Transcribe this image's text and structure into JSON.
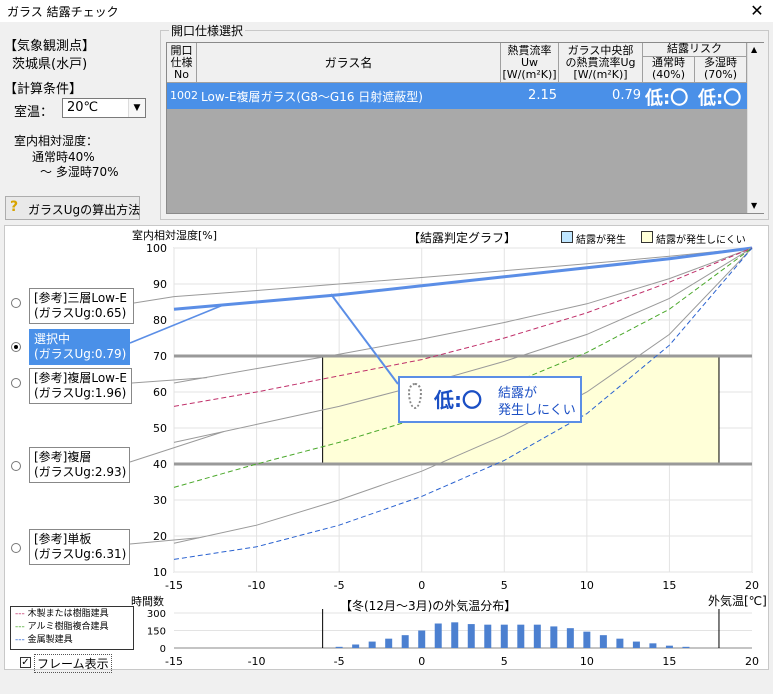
{
  "window": {
    "title": "ガラス 結露チェック",
    "close": "✕"
  },
  "station": {
    "heading": "【気象観測点】",
    "name": "茨城県(水戸)"
  },
  "conditions": {
    "heading": "【計算条件】",
    "room_temp_label": "室温：",
    "room_temp_value": "20℃",
    "humidity_label": "室内相対湿度：",
    "humidity_normal": "通常時40%",
    "humidity_high": "～ 多湿時70%"
  },
  "ug_button": "ガラスUgの算出方法",
  "spec_table": {
    "group_title": "開口仕様選択",
    "headers": {
      "no": [
        "開口",
        "仕様",
        "No"
      ],
      "name": "ガラス名",
      "uw": [
        "熱貫流率",
        "Uw",
        "[W/(m²K)]"
      ],
      "ug": [
        "ガラス中央部",
        "の熱貫流率Ug",
        "[W/(m²K)]"
      ],
      "risk": "結露リスク",
      "normal": [
        "通常時",
        "(40%)"
      ],
      "humid": [
        "多湿時",
        "(70%)"
      ]
    },
    "row": {
      "no": "1002",
      "name": "Low-E複層ガラス(G8～G16 日射遮蔽型)",
      "uw": "2.15",
      "ug": "0.79",
      "normal": "低:〇",
      "humid": "低:〇"
    }
  },
  "graph": {
    "ylabel": "室内相対湿度[%]",
    "title": "【結露判定グラフ】",
    "legend_occurs": "結露が発生",
    "legend_unlikely": "結露が発生しにくい",
    "xlabel": "外気温[℃]",
    "result_main": "低:〇",
    "result_sub1": "結露が",
    "result_sub2": "発生しにくい",
    "yticks": [
      "100",
      "90",
      "80",
      "70",
      "60",
      "50",
      "40",
      "30",
      "20",
      "10"
    ],
    "xticks": [
      "-15",
      "-10",
      "-5",
      "0",
      "5",
      "10",
      "15",
      "20"
    ]
  },
  "glass_options": [
    {
      "label1": "[参考]三層Low-E",
      "label2": "(ガラスUg:0.65)"
    },
    {
      "label1": "選択中",
      "label2": "(ガラスUg:0.79)"
    },
    {
      "label1": "[参考]複層Low-E",
      "label2": "(ガラスUg:1.96)"
    },
    {
      "label1": "[参考]複層",
      "label2": "(ガラスUg:2.93)"
    },
    {
      "label1": "[参考]単板",
      "label2": "(ガラスUg:6.31)"
    }
  ],
  "frame_legend": [
    "木製または樹脂建具",
    "アルミ樹脂複合建具",
    "金属製建具"
  ],
  "hist": {
    "ylabel": "時間数",
    "title": "【冬(12月～3月)の外気温分布】",
    "yticks": [
      "300",
      "150",
      "0"
    ]
  },
  "frame_display": "フレーム表示",
  "chart_data": {
    "type": "line",
    "title": "【結露判定グラフ】",
    "xlabel": "外気温[℃]",
    "ylabel": "室内相対湿度[%]",
    "xlim": [
      -15,
      20
    ],
    "ylim": [
      10,
      100
    ],
    "no_condensation_zone": {
      "x": [
        -6,
        18
      ],
      "y": [
        40,
        70
      ]
    },
    "series": [
      {
        "name": "[参考]三層Low-E",
        "x": [
          -15,
          -10,
          -5,
          0,
          5,
          10,
          15,
          20
        ],
        "y": [
          86.5,
          88.2,
          90,
          91.8,
          93.7,
          95.6,
          97.7,
          100
        ]
      },
      {
        "name": "選択中",
        "x": [
          -15,
          -10,
          -5,
          0,
          5,
          10,
          15,
          20
        ],
        "y": [
          83,
          85,
          87,
          89.5,
          92,
          94.5,
          97,
          100
        ]
      },
      {
        "name": "[参考]複層Low-E",
        "x": [
          -15,
          -10,
          -5,
          0,
          5,
          10,
          15,
          20
        ],
        "y": [
          62.5,
          66.5,
          70.5,
          74.7,
          79.3,
          84.5,
          91.5,
          100
        ]
      },
      {
        "name": "[参考]複層",
        "x": [
          -15,
          -10,
          -5,
          0,
          5,
          10,
          15,
          20
        ],
        "y": [
          46,
          51,
          56,
          62,
          68.5,
          76,
          86,
          100
        ]
      },
      {
        "name": "[参考]単板",
        "x": [
          -15,
          -10,
          -5,
          0,
          5,
          10,
          15,
          20
        ],
        "y": [
          18,
          23,
          30,
          38,
          48,
          60,
          76,
          100
        ]
      },
      {
        "name": "木製または樹脂建具",
        "x": [
          -15,
          -10,
          -5,
          0,
          5,
          10,
          15,
          20
        ],
        "y": [
          56,
          60,
          64.5,
          69,
          75,
          82,
          90.5,
          100
        ]
      },
      {
        "name": "アルミ樹脂複合建具",
        "x": [
          -15,
          -10,
          -5,
          0,
          5,
          10,
          15,
          20
        ],
        "y": [
          33.5,
          40,
          46,
          53,
          61.5,
          71,
          83,
          100
        ]
      },
      {
        "name": "金属製建具",
        "x": [
          -15,
          -10,
          -5,
          0,
          5,
          10,
          15,
          20
        ],
        "y": [
          13.5,
          17,
          23,
          31,
          41,
          54,
          73,
          100
        ]
      }
    ],
    "histogram": {
      "title": "【冬(12月～3月)の外気温分布】",
      "ylabel": "時間数",
      "ylim": [
        0,
        300
      ],
      "x": [
        -5,
        -4,
        -3,
        -2,
        -1,
        0,
        1,
        2,
        3,
        4,
        5,
        6,
        7,
        8,
        9,
        10,
        11,
        12,
        13,
        14,
        15,
        16
      ],
      "values": [
        10,
        30,
        55,
        80,
        110,
        150,
        210,
        220,
        205,
        200,
        200,
        200,
        200,
        185,
        170,
        140,
        110,
        80,
        55,
        40,
        20,
        10
      ]
    }
  }
}
